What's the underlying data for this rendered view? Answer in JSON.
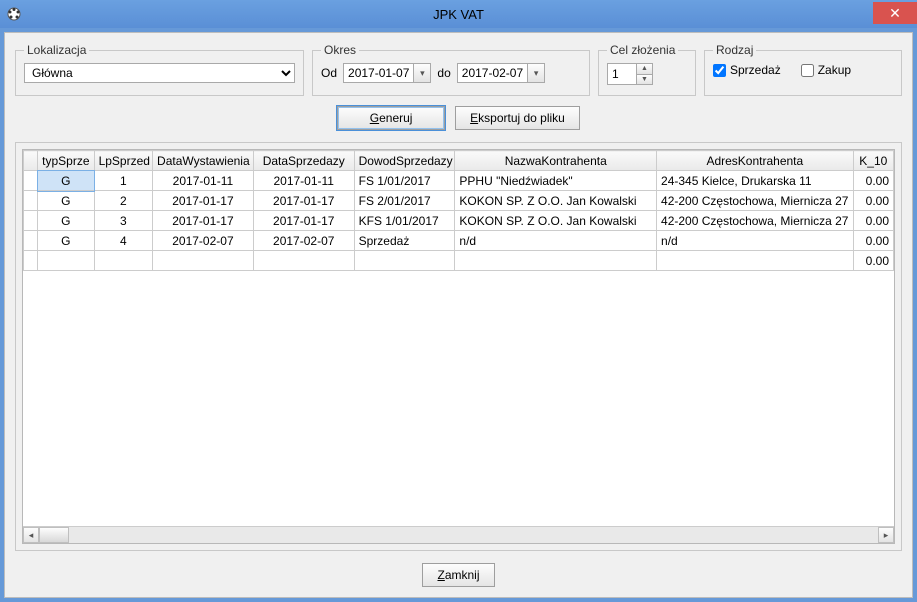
{
  "window": {
    "title": "JPK VAT"
  },
  "filters": {
    "lokalizacja": {
      "label": "Lokalizacja",
      "value": "Główna"
    },
    "okres": {
      "label": "Okres",
      "od_label": "Od",
      "od_value": "2017-01-07",
      "do_label": "do",
      "do_value": "2017-02-07"
    },
    "cel": {
      "label": "Cel złożenia",
      "value": "1"
    },
    "rodzaj": {
      "label": "Rodzaj",
      "sprzedaz_label": "Sprzedaż",
      "sprzedaz_checked": true,
      "zakup_label": "Zakup",
      "zakup_checked": false
    }
  },
  "actions": {
    "generuj_full": "Generuj",
    "generuj_u": "G",
    "generuj_rest": "eneruj",
    "eksport_full": "Eksportuj do pliku",
    "eksport_u": "E",
    "eksport_rest": "ksportuj do pliku",
    "zamknij_full": "Zamknij",
    "zamknij_u": "Z",
    "zamknij_rest": "amknij"
  },
  "grid": {
    "headers": {
      "typ": "typSprze",
      "lp": "LpSprzed",
      "dw": "DataWystawienia",
      "ds": "DataSprzedazy",
      "dow": "DowodSprzedazy",
      "nk": "NazwaKontrahenta",
      "ak": "AdresKontrahenta",
      "k10": "K_10"
    },
    "rows": [
      {
        "typ": "G",
        "lp": "1",
        "dw": "2017-01-11",
        "ds": "2017-01-11",
        "dow": "FS 1/01/2017",
        "nk": "PPHU \"Niedźwiadek\"",
        "ak": "24-345 Kielce, Drukarska 11",
        "k10": "0.00"
      },
      {
        "typ": "G",
        "lp": "2",
        "dw": "2017-01-17",
        "ds": "2017-01-17",
        "dow": "FS 2/01/2017",
        "nk": "KOKON SP. Z O.O. Jan Kowalski",
        "ak": "42-200 Częstochowa, Miernicza 27",
        "k10": "0.00"
      },
      {
        "typ": "G",
        "lp": "3",
        "dw": "2017-01-17",
        "ds": "2017-01-17",
        "dow": "KFS 1/01/2017",
        "nk": "KOKON SP. Z O.O. Jan Kowalski",
        "ak": "42-200 Częstochowa, Miernicza 27",
        "k10": "0.00"
      },
      {
        "typ": "G",
        "lp": "4",
        "dw": "2017-02-07",
        "ds": "2017-02-07",
        "dow": "Sprzedaż",
        "nk": "n/d",
        "ak": "n/d",
        "k10": "0.00"
      }
    ],
    "summary": {
      "k10": "0.00"
    }
  }
}
